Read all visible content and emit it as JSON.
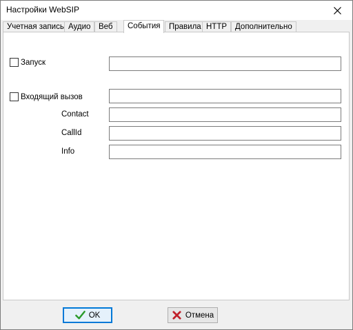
{
  "window": {
    "title": "Настройки WebSIP"
  },
  "tabs": [
    {
      "label": "Учетная запись"
    },
    {
      "label": "Аудио"
    },
    {
      "label": "Веб"
    },
    {
      "label": "События"
    },
    {
      "label": "Правила"
    },
    {
      "label": "HTTP"
    },
    {
      "label": "Дополнительно"
    }
  ],
  "events": {
    "startup": {
      "label": "Запуск",
      "checked": false,
      "value": ""
    },
    "incoming_call": {
      "label": "Входящий вызов",
      "checked": false,
      "value": ""
    },
    "contact": {
      "label": "Contact",
      "value": ""
    },
    "callid": {
      "label": "CallId",
      "value": ""
    },
    "info": {
      "label": "Info",
      "value": ""
    }
  },
  "footer": {
    "ok_label": "OK",
    "cancel_label": "Отмена"
  },
  "icons": {
    "close": "close-icon",
    "ok": "green-checkmark-icon",
    "cancel": "red-x-icon"
  },
  "colors": {
    "ok_icon": "#2a9a2a",
    "cancel_icon": "#c0202a",
    "default_button_border": "#0078d7"
  }
}
